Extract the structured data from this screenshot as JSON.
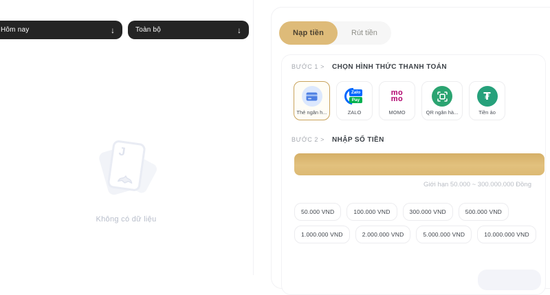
{
  "left_panel": {
    "filters": [
      {
        "label": "Hôm nay",
        "arrow": "↓"
      },
      {
        "label": "Toàn bộ",
        "arrow": "↓"
      }
    ],
    "empty_state": {
      "card_letter": "J",
      "message": "Không có dữ liệu"
    }
  },
  "right_panel": {
    "tabs": [
      {
        "label": "Nạp tiền",
        "active": true
      },
      {
        "label": "Rút tiền",
        "active": false
      }
    ],
    "step1": {
      "prefix": "BƯỚC 1 >",
      "title": "CHỌN HÌNH THỨC THANH TOÁN"
    },
    "step2": {
      "prefix": "BƯỚC 2 >",
      "title": "NHẬP SỐ TIỀN"
    },
    "payment_methods": [
      {
        "label": "Thẻ ngân h...",
        "icon": "bank-card-icon",
        "selected": true
      },
      {
        "label": "ZALO",
        "icon": "zalopay-icon",
        "selected": false,
        "icon_text": {
          "line1": "Zalo",
          "line2": "Pay"
        }
      },
      {
        "label": "MOMO",
        "icon": "momo-icon",
        "selected": false,
        "icon_text": {
          "line1": "mo",
          "line2": "mo"
        }
      },
      {
        "label": "QR ngân hà...",
        "icon": "qr-bank-icon",
        "selected": false
      },
      {
        "label": "Tiền ảo",
        "icon": "tether-icon",
        "selected": false,
        "icon_text": {
          "symbol": "₮"
        }
      }
    ],
    "amount_input": {
      "value": "",
      "limit_note": "Giới hạn 50.000 ~ 300.000.000 Đồng"
    },
    "quick_amounts": [
      "50.000 VND",
      "100.000 VND",
      "300.000 VND",
      "500.000 VND",
      "1.000.000 VND",
      "2.000.000 VND",
      "5.000.000 VND",
      "10.000.000 VND"
    ],
    "colors": {
      "accent_gold": "#debb79",
      "momo_pink": "#b0006d",
      "zalopay_blue": "#0068ff",
      "zalopay_green": "#00b14f",
      "tether_teal": "#26a17b",
      "qr_green": "#2ba471",
      "bank_blue": "#4d7fe3"
    }
  }
}
